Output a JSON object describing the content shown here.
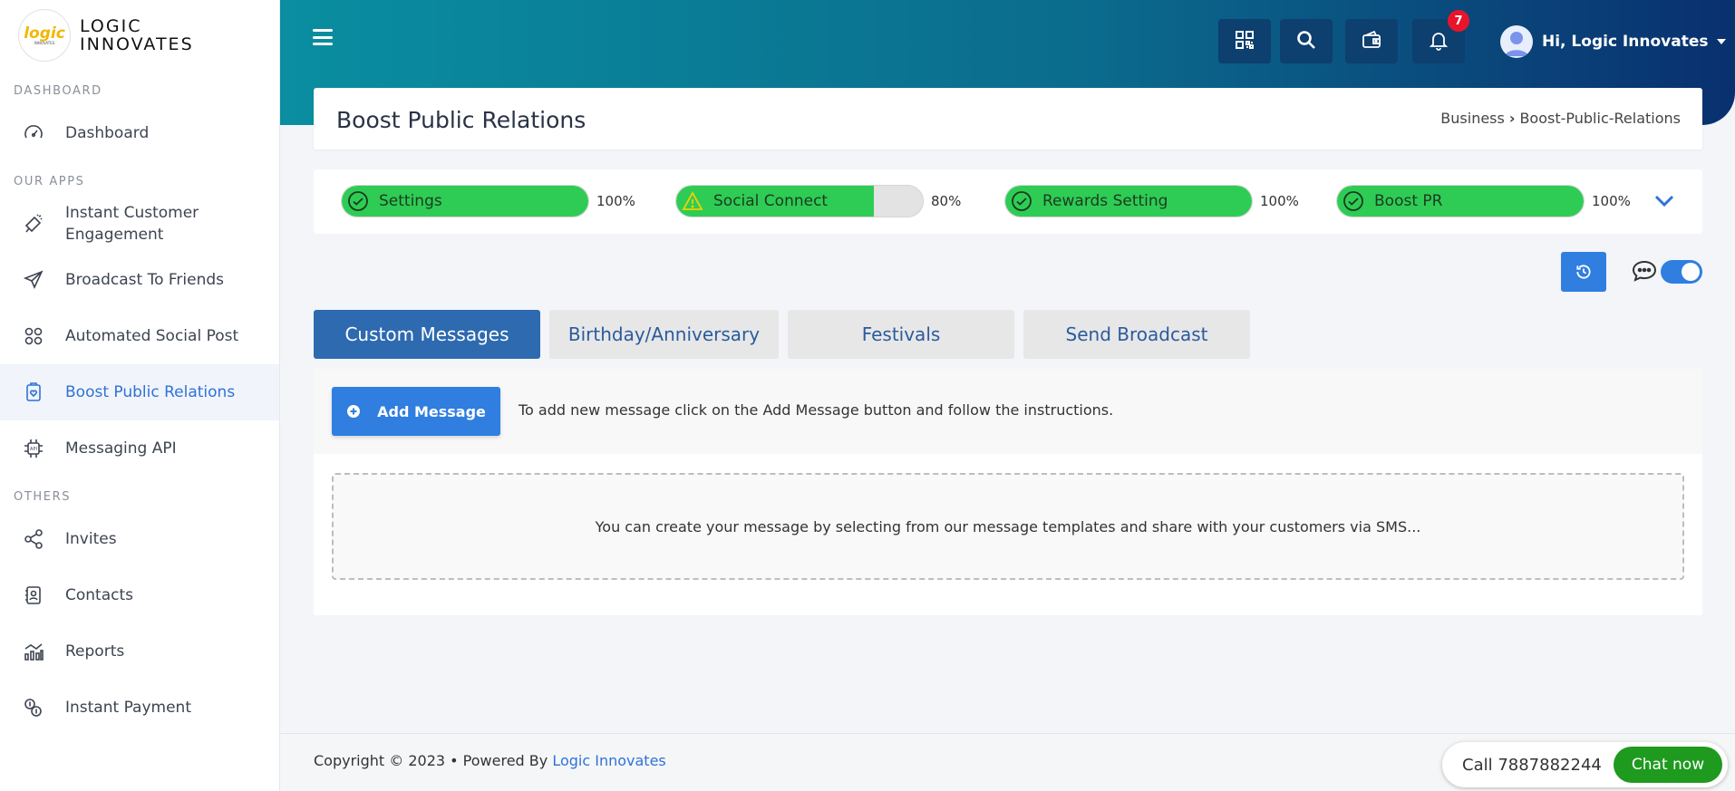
{
  "brand": {
    "logo_word": "logic",
    "logo_sub": "INNOVATES",
    "line1": "LOGIC",
    "line2": "INNOVATES"
  },
  "sidebar": {
    "sections": [
      {
        "title": "DASHBOARD"
      },
      {
        "title": "OUR APPS"
      },
      {
        "title": "OTHERS"
      }
    ],
    "items": [
      {
        "label": "Dashboard",
        "icon": "speedometer-icon"
      },
      {
        "label": "Instant Customer Engagement",
        "icon": "megaphone-icon"
      },
      {
        "label": "Broadcast To Friends",
        "icon": "paper-plane-icon"
      },
      {
        "label": "Automated Social Post",
        "icon": "grid-nodes-icon"
      },
      {
        "label": "Boost Public Relations",
        "icon": "clipboard-heart-icon",
        "active": true
      },
      {
        "label": "Messaging API",
        "icon": "api-chip-icon"
      },
      {
        "label": "Invites",
        "icon": "share-icon"
      },
      {
        "label": "Contacts",
        "icon": "contact-book-icon"
      },
      {
        "label": "Reports",
        "icon": "chart-icon"
      },
      {
        "label": "Instant Payment",
        "icon": "payment-icon"
      }
    ]
  },
  "header": {
    "notification_count": "7",
    "user_greeting": "Hi, Logic Innovates"
  },
  "page": {
    "title": "Boost Public Relations",
    "breadcrumb": [
      "Business",
      "Boost-Public-Relations"
    ]
  },
  "progress": [
    {
      "label": "Settings",
      "percent_text": "100%",
      "status": "complete",
      "fill": 1.0
    },
    {
      "label": "Social Connect",
      "percent_text": "80%",
      "status": "warning",
      "fill": 0.8
    },
    {
      "label": "Rewards Setting",
      "percent_text": "100%",
      "status": "complete",
      "fill": 1.0
    },
    {
      "label": "Boost PR",
      "percent_text": "100%",
      "status": "complete",
      "fill": 1.0
    }
  ],
  "tabs": [
    {
      "label": "Custom Messages",
      "active": true
    },
    {
      "label": "Birthday/Anniversary"
    },
    {
      "label": "Festivals"
    },
    {
      "label": "Send Broadcast"
    }
  ],
  "content": {
    "add_button": "Add Message",
    "hint": "To add new message click on the Add Message button and follow the instructions.",
    "empty_text": "You can create your message by selecting from our message templates and share with your customers via SMS..."
  },
  "footer": {
    "copyright": "Copyright © 2023  • Powered By",
    "company_link": "Logic Innovates",
    "call_text": "Call 7887882244",
    "chat_button": "Chat now"
  },
  "colors": {
    "accent": "#2f7ee0",
    "progress_green": "#2ecc55",
    "header_start": "#0a8ea0",
    "header_end": "#09306f",
    "badge": "#e8142a",
    "chat_green": "#1e9a1e"
  }
}
